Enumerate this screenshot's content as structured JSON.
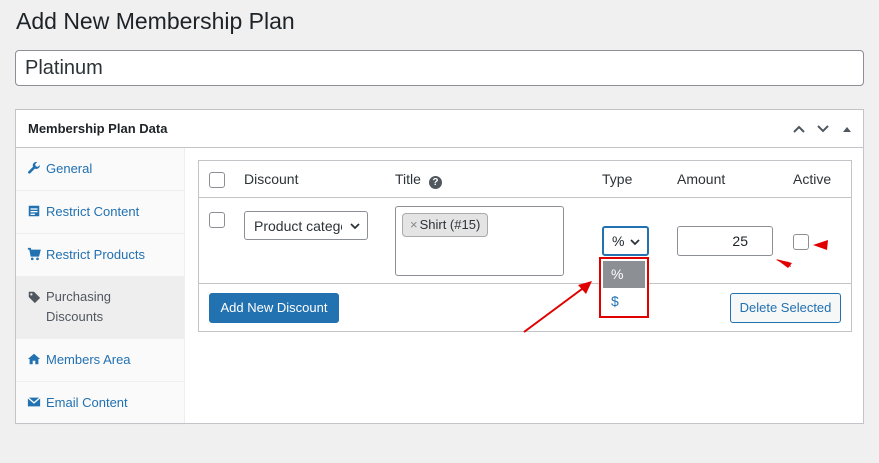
{
  "page": {
    "title": "Add New Membership Plan"
  },
  "plan_title": {
    "value": "Platinum"
  },
  "metabox": {
    "title": "Membership Plan Data"
  },
  "sidebar": {
    "tabs": [
      {
        "label": "General",
        "icon": "wrench-icon"
      },
      {
        "label": "Restrict Content",
        "icon": "document-icon"
      },
      {
        "label": "Restrict Products",
        "icon": "cart-icon"
      },
      {
        "label": "Purchasing Discounts",
        "icon": "tag-icon",
        "active": true
      },
      {
        "label": "Members Area",
        "icon": "home-icon"
      },
      {
        "label": "Email Content",
        "icon": "email-icon"
      }
    ]
  },
  "discounts_table": {
    "headers": {
      "discount": "Discount",
      "title": "Title",
      "type": "Type",
      "amount": "Amount",
      "active": "Active"
    },
    "row": {
      "discount_select": "Product categories",
      "title_tag": "Shirt (#15)",
      "type_value": "%",
      "amount": "25",
      "active": false
    },
    "type_options": [
      "%",
      "$"
    ],
    "add_button": "Add New Discount",
    "delete_button": "Delete Selected"
  },
  "colors": {
    "primary": "#2271b1",
    "annotation": "#e00000"
  }
}
